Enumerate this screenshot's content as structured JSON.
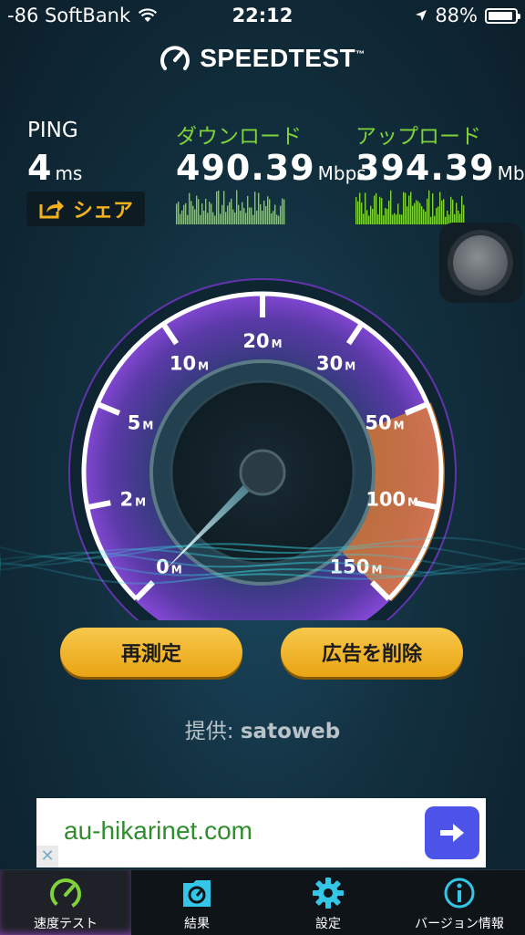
{
  "status": {
    "carrier": "-86 SoftBank",
    "time": "22:12",
    "battery": "88%"
  },
  "brand": {
    "name": "SPEEDTEST",
    "trademark": "™"
  },
  "ping": {
    "label": "PING",
    "value": "4",
    "unit": "ms"
  },
  "download": {
    "label": "ダウンロード",
    "value": "490.39",
    "unit": "Mbps"
  },
  "upload": {
    "label": "アップロード",
    "value": "394.39",
    "unit": "Mbps"
  },
  "share": {
    "label": "シェア",
    "icon": "share-icon"
  },
  "gauge": {
    "ticks": [
      {
        "num": "0",
        "suffix": "M"
      },
      {
        "num": "2",
        "suffix": "M"
      },
      {
        "num": "5",
        "suffix": "M"
      },
      {
        "num": "10",
        "suffix": "M"
      },
      {
        "num": "20",
        "suffix": "M"
      },
      {
        "num": "30",
        "suffix": "M"
      },
      {
        "num": "50",
        "suffix": "M"
      },
      {
        "num": "100",
        "suffix": "M"
      },
      {
        "num": "150",
        "suffix": "M"
      }
    ],
    "colors": {
      "ring": "#ffffff",
      "glow": "#8a3fe0",
      "overflow": "#e9822a"
    }
  },
  "buttons": {
    "retest": "再測定",
    "remove_ads": "広告を削除"
  },
  "provider": {
    "prefix": "提供: ",
    "name": "satoweb"
  },
  "ad": {
    "text": "au-hikarinet.com",
    "close": "✕",
    "accent": "#4d52e8"
  },
  "tabs": [
    {
      "label": "速度テスト",
      "icon": "speedometer-icon",
      "active": true
    },
    {
      "label": "結果",
      "icon": "results-icon",
      "active": false
    },
    {
      "label": "設定",
      "icon": "gear-icon",
      "active": false
    },
    {
      "label": "バージョン情報",
      "icon": "info-icon",
      "active": false
    }
  ],
  "accent_colors": {
    "green": "#7fd23a",
    "yellow": "#f3b21b",
    "cyan": "#33c6e6"
  }
}
